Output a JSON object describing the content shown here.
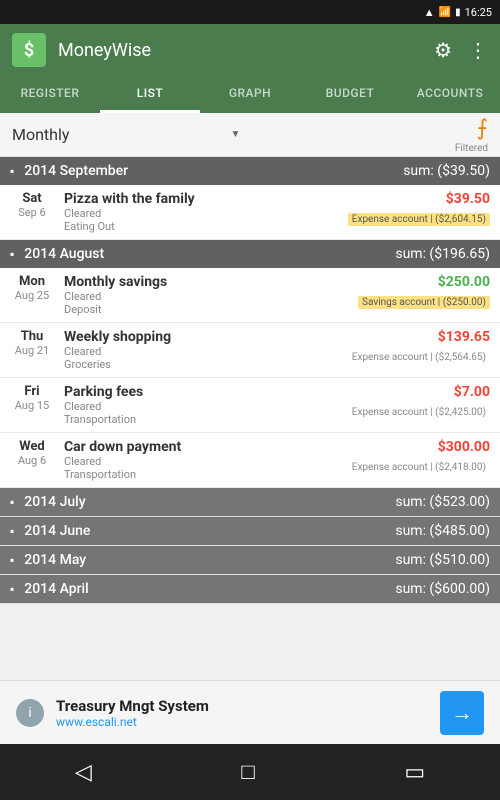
{
  "statusBar": {
    "time": "16:25",
    "signal": "▲▼",
    "wifi": "wifi",
    "battery": "battery"
  },
  "appBar": {
    "logo": "$",
    "title": "MoneyWise",
    "settingsIcon": "⚙",
    "moreIcon": "⋮"
  },
  "tabs": [
    {
      "id": "register",
      "label": "REGISTER",
      "active": false
    },
    {
      "id": "list",
      "label": "LIST",
      "active": true
    },
    {
      "id": "graph",
      "label": "GRAPH",
      "active": false
    },
    {
      "id": "budget",
      "label": "BUDGET",
      "active": false
    },
    {
      "id": "accounts",
      "label": "ACCOUNTS",
      "active": false
    }
  ],
  "filterBar": {
    "label": "Monthly",
    "arrowIcon": "▼",
    "filterIcon": "⧩",
    "filteredText": "Filtered"
  },
  "sections": [
    {
      "id": "sep2014",
      "title": "2014 September",
      "sum": "sum: ($39.50)",
      "expanded": true,
      "transactions": [
        {
          "dayName": "Sat",
          "date": "Sep 6",
          "name": "Pizza with the family",
          "status": "Cleared",
          "category": "Eating Out",
          "amount": "$39.50",
          "amountColor": "red",
          "account": "Expense account | ($2,604.15)",
          "accountStyle": "yellow"
        }
      ]
    },
    {
      "id": "aug2014",
      "title": "2014 August",
      "sum": "sum: ($196.65)",
      "expanded": true,
      "transactions": [
        {
          "dayName": "Mon",
          "date": "Aug 25",
          "name": "Monthly savings",
          "status": "Cleared",
          "category": "Deposit",
          "amount": "$250.00",
          "amountColor": "green",
          "account": "Savings account | ($250.00)",
          "accountStyle": "yellow"
        },
        {
          "dayName": "Thu",
          "date": "Aug 21",
          "name": "Weekly shopping",
          "status": "Cleared",
          "category": "Groceries",
          "amount": "$139.65",
          "amountColor": "red",
          "account": "Expense account | ($2,564.65)",
          "accountStyle": "plain"
        },
        {
          "dayName": "Fri",
          "date": "Aug 15",
          "name": "Parking fees",
          "status": "Cleared",
          "category": "Transportation",
          "amount": "$7.00",
          "amountColor": "red",
          "account": "Expense account | ($2,425.00)",
          "accountStyle": "plain"
        },
        {
          "dayName": "Wed",
          "date": "Aug 6",
          "name": "Car down payment",
          "status": "Cleared",
          "category": "Transportation",
          "amount": "$300.00",
          "amountColor": "red",
          "account": "Expense account | ($2,418.00)",
          "accountStyle": "plain"
        }
      ]
    },
    {
      "id": "jul2014",
      "title": "2014 July",
      "sum": "sum: ($523.00)",
      "expanded": false,
      "transactions": []
    },
    {
      "id": "jun2014",
      "title": "2014 June",
      "sum": "sum: ($485.00)",
      "expanded": false,
      "transactions": []
    },
    {
      "id": "may2014",
      "title": "2014 May",
      "sum": "sum: ($510.00)",
      "expanded": false,
      "transactions": []
    },
    {
      "id": "apr2014",
      "title": "2014 April",
      "sum": "sum: ($600.00)",
      "expanded": false,
      "transactions": []
    }
  ],
  "adBanner": {
    "infoIcon": "i",
    "title": "Treasury Mngt System",
    "url": "www.escali.net",
    "arrowIcon": "→"
  },
  "bottomNav": {
    "backIcon": "◁",
    "homeIcon": "□",
    "recentIcon": "▭"
  }
}
